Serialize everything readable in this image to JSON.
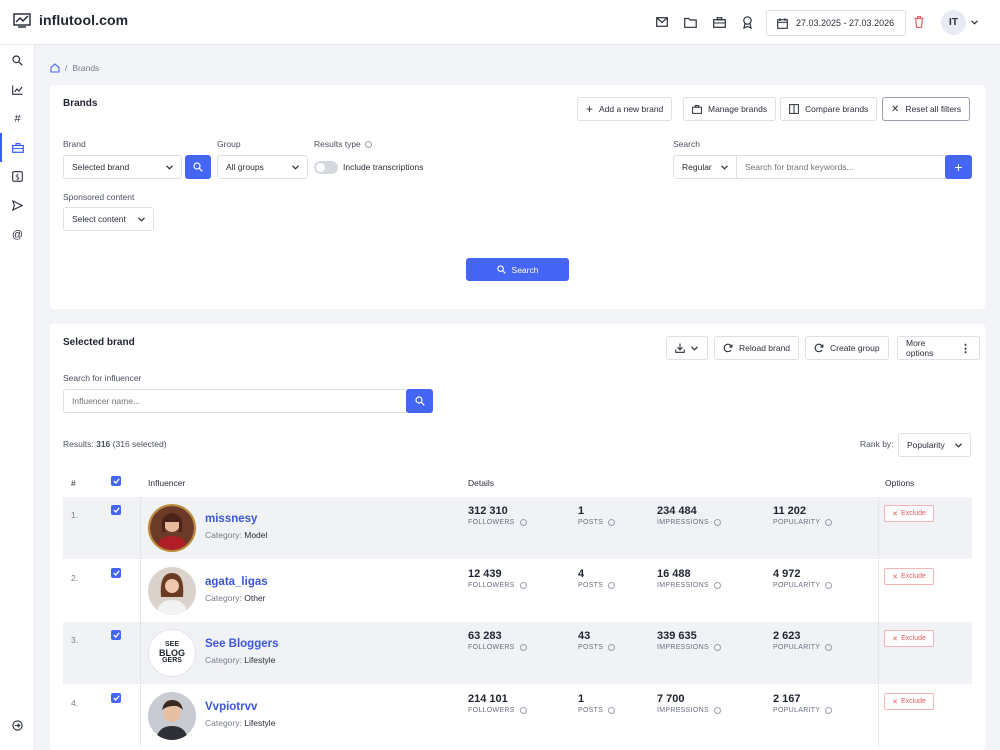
{
  "app": {
    "logo_text": "influtool.com"
  },
  "topbar": {
    "date_range": "27.03.2025 - 27.03.2026",
    "user_initials": "IT"
  },
  "breadcrumb": {
    "current": "Brands"
  },
  "brands_panel": {
    "title": "Brands",
    "buttons": {
      "add": "Add a new brand",
      "manage": "Manage brands",
      "compare": "Compare brands",
      "reset": "Reset all filters"
    },
    "brand_label": "Brand",
    "brand_value": "Selected brand",
    "group_label": "Group",
    "group_value": "All groups",
    "results_type_label": "Results type",
    "include_transcriptions": "Include transcriptions",
    "search_label": "Search",
    "search_mode": "Regular",
    "search_placeholder": "Search for brand keywords...",
    "sponsored_label": "Sponsored content",
    "sponsored_value": "Select content",
    "search_button": "Search"
  },
  "selected_panel": {
    "title": "Selected brand",
    "buttons": {
      "reload": "Reload brand",
      "create_group": "Create group",
      "more": "More options"
    },
    "influencer_search_label": "Search for influencer",
    "influencer_placeholder": "Influencer name...",
    "results_prefix": "Results:",
    "results_count": "316",
    "results_selected": "(316 selected)",
    "rank_by_label": "Rank by:",
    "rank_by_value": "Popularity"
  },
  "table": {
    "headers": {
      "num": "#",
      "influencer": "Influencer",
      "details": "Details",
      "options": "Options"
    },
    "stat_labels": {
      "followers": "FOLLOWERS",
      "posts": "POSTS",
      "impressions": "IMPRESSIONS",
      "popularity": "POPULARITY"
    },
    "category_prefix": "Category:",
    "exclude_label": "Exclude",
    "rows": [
      {
        "rank": "1.",
        "name": "missnesy",
        "category": "Model",
        "followers": "312 310",
        "posts": "1",
        "impressions": "234 484",
        "popularity": "11 202"
      },
      {
        "rank": "2.",
        "name": "agata_ligas",
        "category": "Other",
        "followers": "12 439",
        "posts": "4",
        "impressions": "16 488",
        "popularity": "4 972"
      },
      {
        "rank": "3.",
        "name": "See Bloggers",
        "category": "Lifestyle",
        "followers": "63 283",
        "posts": "43",
        "impressions": "339 635",
        "popularity": "2 623"
      },
      {
        "rank": "4.",
        "name": "Vvpiotrvv",
        "category": "Lifestyle",
        "followers": "214 101",
        "posts": "1",
        "impressions": "7 700",
        "popularity": "2 167"
      }
    ]
  },
  "avatar_text": {
    "row3": [
      "SEE",
      "BLOG",
      "GERS"
    ]
  },
  "colors": {
    "accent": "#4565f5",
    "link": "#3b56d9",
    "danger": "#e45d63"
  }
}
